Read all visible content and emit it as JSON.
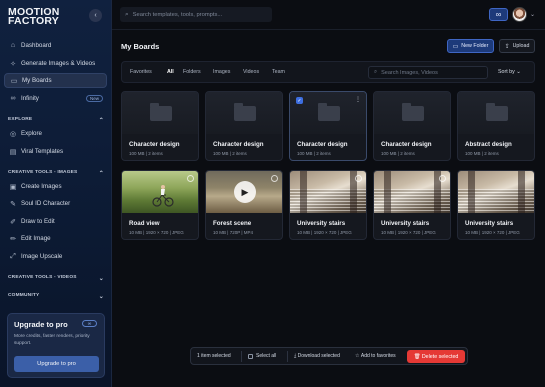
{
  "sidebar": {
    "logo": "MOOTION FACTORY",
    "nav": [
      {
        "label": "Dashboard",
        "icon": "home-icon"
      },
      {
        "label": "Generate Images & Videos",
        "icon": "sparkle-icon"
      },
      {
        "label": "My Boards",
        "icon": "folder-icon"
      },
      {
        "label": "Infinity",
        "icon": "infinity-icon",
        "badge": "New"
      }
    ],
    "explore_label": "EXPLORE",
    "explore": [
      {
        "label": "Explore",
        "icon": "compass-icon"
      },
      {
        "label": "Viral Templates",
        "icon": "template-icon"
      }
    ],
    "creative_images_label": "CREATIVE TOOLS - IMAGES",
    "creative_images": [
      {
        "label": "Create Images",
        "icon": "image-icon"
      },
      {
        "label": "Soul ID Character",
        "icon": "wand-icon"
      },
      {
        "label": "Draw to Edit",
        "icon": "brush-icon"
      },
      {
        "label": "Edit Image",
        "icon": "edit-icon"
      },
      {
        "label": "Image Upscale",
        "icon": "upscale-icon"
      }
    ],
    "creative_videos_label": "CREATIVE TOOLS - VIDEOS",
    "community_label": "COMMUNITY",
    "upgrade": {
      "title": "Upgrade to pro",
      "description": "More credits, faster renders, priority support.",
      "button": "Upgrade to pro"
    }
  },
  "header": {
    "search_placeholder": "Search templates, tools, prompts..."
  },
  "main": {
    "title": "My Boards",
    "new_folder": "New Folder",
    "upload": "Upload",
    "filters": [
      "Favorites",
      "All",
      "Folders",
      "Images",
      "Videos",
      "Team"
    ],
    "active_filter": "All",
    "filter_search_placeholder": "Search Images, Videos",
    "sort_label": "Sort by",
    "folders": [
      {
        "name": "Character design",
        "size": "100 MB",
        "items": "2 items",
        "selected": false
      },
      {
        "name": "Character design",
        "size": "100 MB",
        "items": "2 items",
        "selected": false
      },
      {
        "name": "Character design",
        "size": "100 MB",
        "items": "2 items",
        "selected": true
      },
      {
        "name": "Character design",
        "size": "100 MB",
        "items": "2 items",
        "selected": false
      },
      {
        "name": "Abstract design",
        "size": "100 MB",
        "items": "2 items",
        "selected": false
      }
    ],
    "media": [
      {
        "name": "Road view",
        "size": "10 MB",
        "res": "1920 × 720",
        "format": "JPEG"
      },
      {
        "name": "Forest scene",
        "size": "10 MB",
        "res": "720P",
        "format": "MP4"
      },
      {
        "name": "University stairs",
        "size": "10 MB",
        "res": "1920 × 720",
        "format": "JPEG"
      },
      {
        "name": "University stairs",
        "size": "10 MB",
        "res": "1920 × 720",
        "format": "JPEG"
      },
      {
        "name": "University stairs",
        "size": "10 MB",
        "res": "1920 × 720",
        "format": "JPEG"
      }
    ]
  },
  "selection_bar": {
    "count": "1 item selected",
    "select_all": "Select all",
    "download": "Download selected",
    "favorites": "Add to favorites",
    "delete": "Delete selected"
  },
  "colors": {
    "accent": "#3d6ee0",
    "danger": "#e53935",
    "sidebar_bg": "#10213f"
  }
}
